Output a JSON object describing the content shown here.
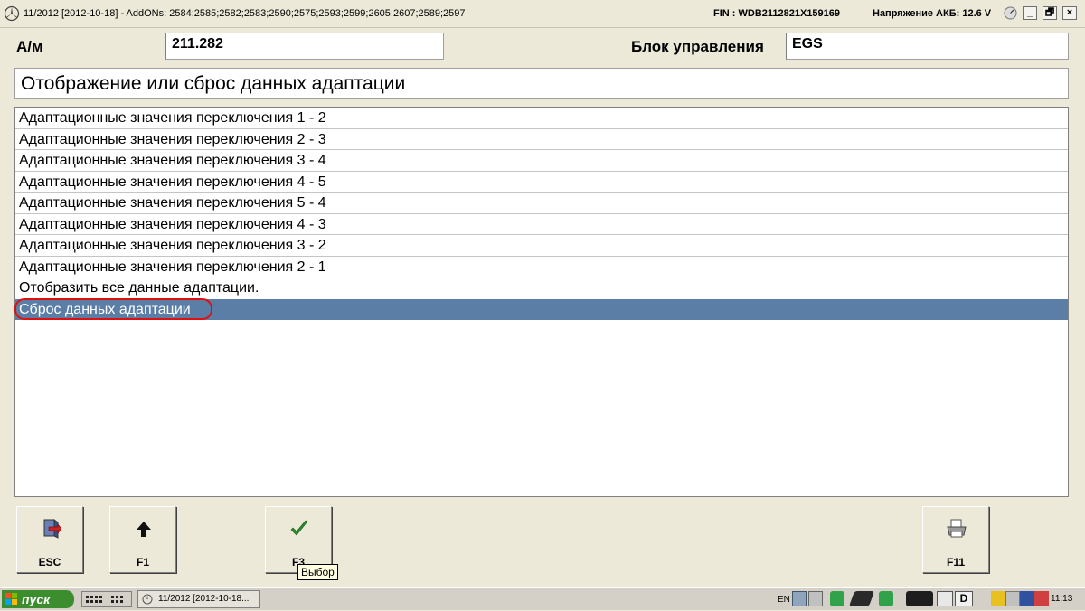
{
  "titlebar": {
    "title": "11/2012 [2012-10-18] - AddONs: 2584;2585;2582;2583;2590;2575;2593;2599;2605;2607;2589;2597",
    "fin": "FIN : WDB2112821X159169",
    "voltage": "Напряжение АКБ: 12.6 V",
    "minimize": "_",
    "restore": "🗗",
    "close": "×"
  },
  "header": {
    "am_label": "А/м",
    "am_value": "211.282",
    "block_label": "Блок управления",
    "block_value": "EGS"
  },
  "heading": "Отображение или сброс данных адаптации",
  "list": {
    "items": [
      "Адаптационные значения переключения 1 - 2",
      "Адаптационные значения переключения 2 - 3",
      "Адаптационные значения переключения 3 - 4",
      "Адаптационные значения переключения 4 - 5",
      "Адаптационные значения переключения 5 - 4",
      "Адаптационные значения переключения 4 - 3",
      "Адаптационные значения переключения 3 - 2",
      "Адаптационные значения переключения 2 - 1",
      "Отобразить все данные адаптации.",
      "Сброс данных адаптации"
    ],
    "selected_index": 9
  },
  "buttons": {
    "esc": "ESC",
    "f1": "F1",
    "f3": "F3",
    "f11": "F11",
    "f3_tooltip": "Выбор"
  },
  "taskbar": {
    "start_label": "пуск",
    "task_label": "11/2012 [2012-10-18...",
    "lang": "EN",
    "drive_label": "D",
    "time": "11:13"
  },
  "colors": {
    "selection": "#5b7ea6",
    "highlight_circle": "#e01010",
    "check_green": "#2e8b2e",
    "start_green": "#3c8d2e"
  }
}
